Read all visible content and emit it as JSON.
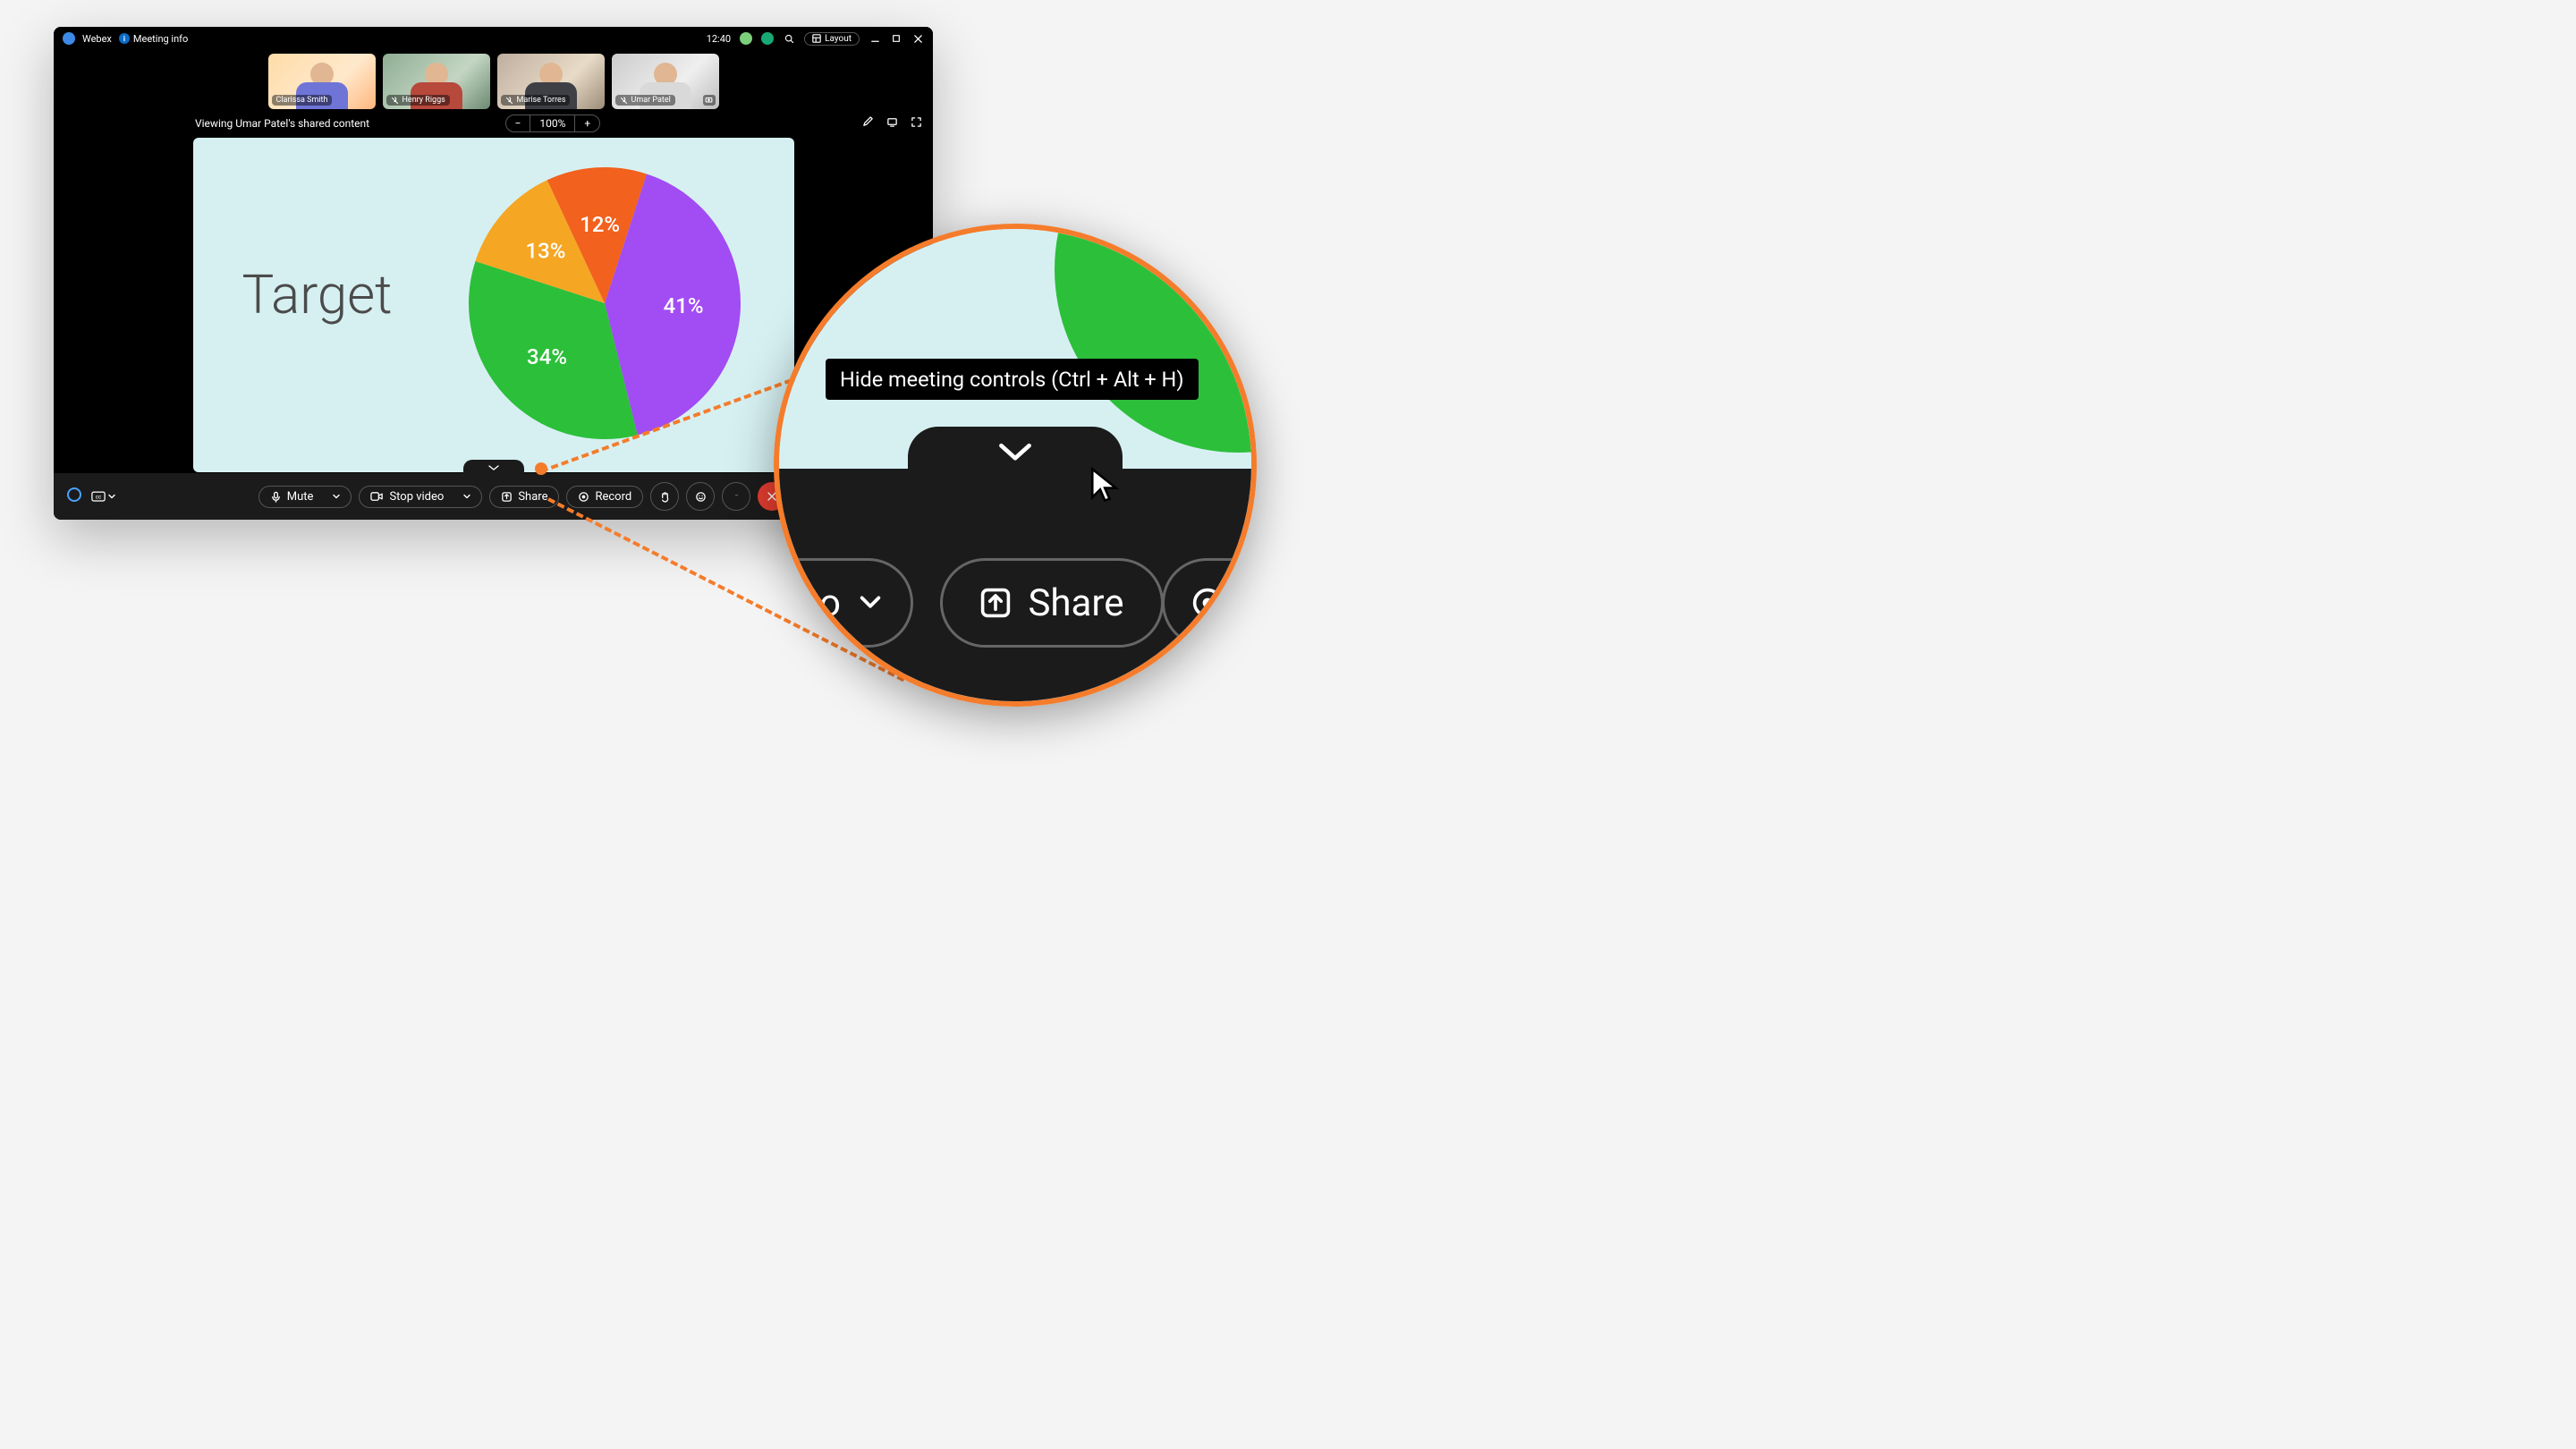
{
  "titlebar": {
    "appname": "Webex",
    "meeting_info": "Meeting info",
    "clock": "12:40",
    "layout_label": "Layout"
  },
  "filmstrip": [
    {
      "name": "Clarissa Smith",
      "muted": false,
      "sharing": false
    },
    {
      "name": "Henry Riggs",
      "muted": true,
      "sharing": false
    },
    {
      "name": "Marise Torres",
      "muted": true,
      "sharing": false
    },
    {
      "name": "Umar Patel",
      "muted": true,
      "sharing": true
    }
  ],
  "share_header": {
    "viewing_text": "Viewing Umar Patel's shared content",
    "zoom_level": "100%"
  },
  "slide": {
    "title": "Target"
  },
  "chart_data": {
    "type": "pie",
    "title": "Target",
    "slices": [
      {
        "label": "41%",
        "value": 41,
        "color": "#a24cf3",
        "start": -72,
        "end": 76
      },
      {
        "label": "34%",
        "value": 34,
        "color": "#2cbf3a",
        "start": 76,
        "end": 198
      },
      {
        "label": "13%",
        "value": 13,
        "color": "#f5a623",
        "start": 198,
        "end": 245
      },
      {
        "label": "12%",
        "value": 12,
        "color": "#f2611d",
        "start": 245,
        "end": 288
      }
    ]
  },
  "toolbar": {
    "mute": "Mute",
    "stop_video": "Stop video",
    "share": "Share",
    "record": "Record"
  },
  "magnifier": {
    "tooltip": "Hide meeting controls (Ctrl + Alt + H)",
    "video_partial": "deo",
    "share": "Share"
  }
}
